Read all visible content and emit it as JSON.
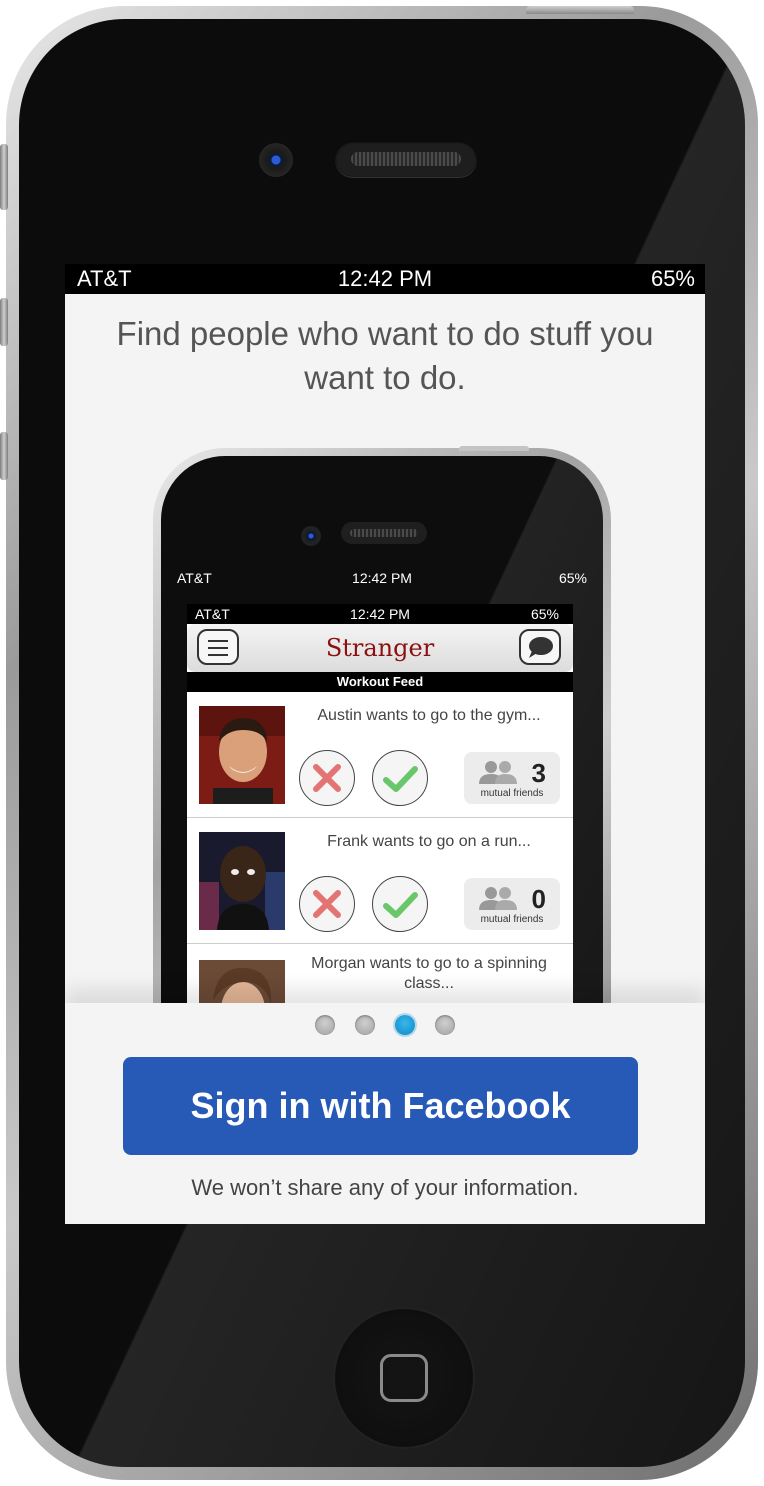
{
  "status_bar": {
    "carrier": "AT&T",
    "time": "12:42 PM",
    "battery": "65%"
  },
  "headline": "Find people who want to do stuff you want to do.",
  "preview": {
    "device_status": {
      "carrier": "AT&T",
      "time": "12:42 PM",
      "battery": "65%"
    },
    "app_status": {
      "carrier": "AT&T",
      "time": "12:42 PM",
      "battery": "65%"
    },
    "app_title": "Stranger",
    "feed_label": "Workout Feed",
    "menu_icon": "hamburger-menu-icon",
    "chat_icon": "chat-bubble-icon",
    "feed_items": [
      {
        "text": "Austin wants to go to the gym...",
        "mutual_count": "3",
        "mutual_label": "mutual friends"
      },
      {
        "text": "Frank wants to go on a run...",
        "mutual_count": "0",
        "mutual_label": "mutual friends"
      },
      {
        "text": "Morgan wants to go to a spinning class..."
      }
    ]
  },
  "pager": {
    "count": 4,
    "active_index": 2
  },
  "facebook_button": "Sign in with Facebook",
  "privacy_note": "We won’t share any of your information.",
  "colors": {
    "facebook_blue": "#2759b7",
    "active_dot": "#1ba0dc",
    "app_title": "#8b1111",
    "reject": "#e06060",
    "accept": "#63c463"
  }
}
